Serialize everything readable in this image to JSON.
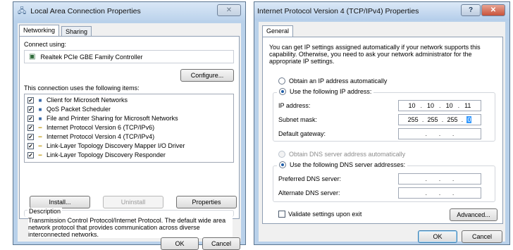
{
  "left_window": {
    "title": "Local Area Connection Properties",
    "tabs": [
      "Networking",
      "Sharing"
    ],
    "connect_using_label": "Connect using:",
    "adapter_name": "Realtek PCIe GBE Family Controller",
    "configure_button": "Configure...",
    "items_label": "This connection uses the following items:",
    "items": [
      {
        "label": "Client for Microsoft Networks",
        "checked": true,
        "icon": "network-client-icon"
      },
      {
        "label": "QoS Packet Scheduler",
        "checked": true,
        "icon": "network-service-icon"
      },
      {
        "label": "File and Printer Sharing for Microsoft Networks",
        "checked": true,
        "icon": "network-service-icon"
      },
      {
        "label": "Internet Protocol Version 6 (TCP/IPv6)",
        "checked": true,
        "icon": "protocol-icon"
      },
      {
        "label": "Internet Protocol Version 4 (TCP/IPv4)",
        "checked": true,
        "icon": "protocol-icon"
      },
      {
        "label": "Link-Layer Topology Discovery Mapper I/O Driver",
        "checked": true,
        "icon": "protocol-icon"
      },
      {
        "label": "Link-Layer Topology Discovery Responder",
        "checked": true,
        "icon": "protocol-icon"
      }
    ],
    "install_button": "Install...",
    "uninstall_button": "Uninstall",
    "properties_button": "Properties",
    "description_label": "Description",
    "description_text": "Transmission Control Protocol/Internet Protocol. The default wide area network protocol that provides communication across diverse interconnected networks.",
    "ok_button": "OK",
    "cancel_button": "Cancel",
    "close_glyph": "✕"
  },
  "right_window": {
    "title": "Internet Protocol Version 4 (TCP/IPv4) Properties",
    "help_glyph": "?",
    "close_glyph": "✕",
    "tab_label": "General",
    "intro_text": "You can get IP settings assigned automatically if your network supports this capability. Otherwise, you need to ask your network administrator for the appropriate IP settings.",
    "obtain_ip_auto": "Obtain an IP address automatically",
    "use_following_ip": "Use the following IP address:",
    "ip_address_label": "IP address:",
    "ip_address_octets": [
      "10",
      "10",
      "10",
      "11"
    ],
    "subnet_mask_label": "Subnet mask:",
    "subnet_mask_octets": [
      "255",
      "255",
      "255",
      "0"
    ],
    "default_gateway_label": "Default gateway:",
    "obtain_dns_auto": "Obtain DNS server address automatically",
    "use_following_dns": "Use the following DNS server addresses:",
    "preferred_dns_label": "Preferred DNS server:",
    "alternate_dns_label": "Alternate DNS server:",
    "validate_label": "Validate settings upon exit",
    "advanced_button": "Advanced...",
    "ok_button": "OK",
    "cancel_button": "Cancel"
  },
  "colors": {
    "title_bar": "#bcd3ec",
    "dialog_bg": "#f0f0f0",
    "selection": "#3399ff",
    "close_button": "#c8523a"
  }
}
